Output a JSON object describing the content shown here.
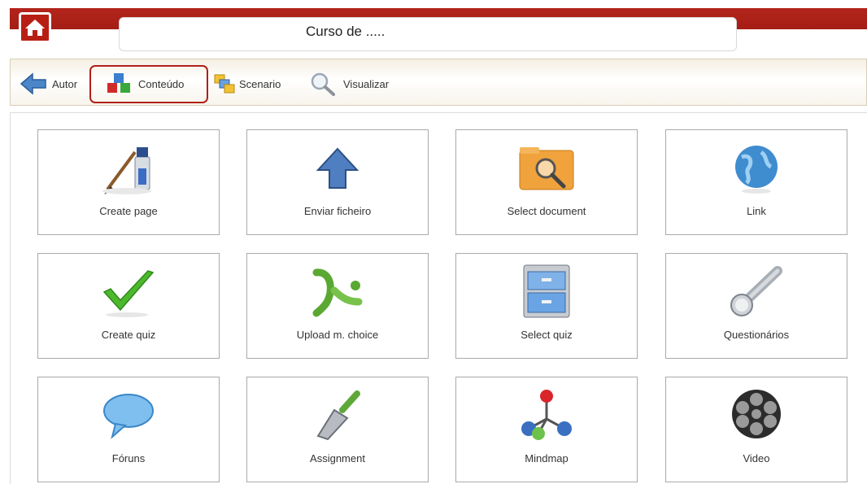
{
  "header": {
    "title": "Curso de ....."
  },
  "toolbar": {
    "items": [
      {
        "label": "Autor"
      },
      {
        "label": "Conteúdo",
        "selected": true
      },
      {
        "label": "Scenario"
      },
      {
        "label": "Visualizar"
      }
    ]
  },
  "tiles": [
    {
      "label": "Create page"
    },
    {
      "label": "Enviar ficheiro"
    },
    {
      "label": "Select document"
    },
    {
      "label": "Link"
    },
    {
      "label": "Create quiz"
    },
    {
      "label": "Upload m. choice"
    },
    {
      "label": "Select quiz"
    },
    {
      "label": "Questionários"
    },
    {
      "label": "Fóruns"
    },
    {
      "label": "Assignment"
    },
    {
      "label": "Mindmap"
    },
    {
      "label": "Video"
    }
  ],
  "colors": {
    "brand_red": "#b3251c",
    "selection_outline": "#b02018"
  }
}
